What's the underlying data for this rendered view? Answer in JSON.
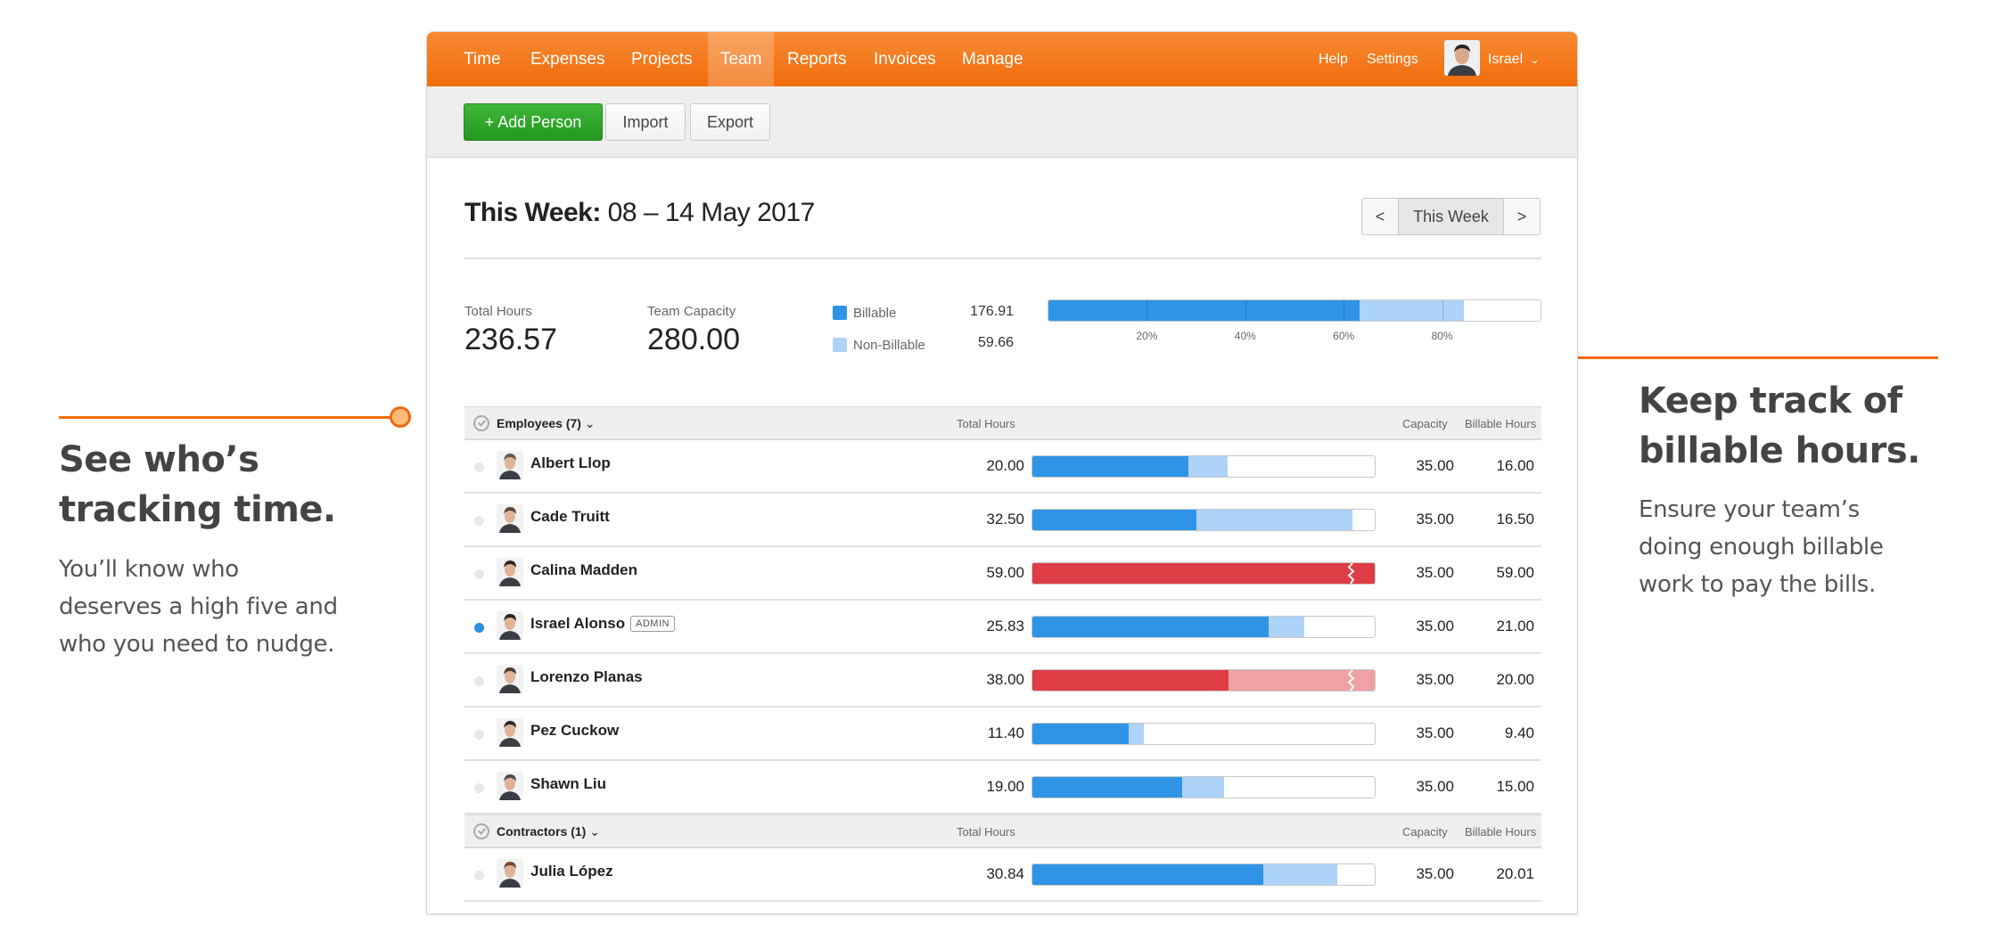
{
  "callouts": {
    "left": {
      "title_lines": [
        "See who’s",
        "tracking time."
      ],
      "body_lines": [
        "You’ll know who",
        "deserves a high five and",
        "who you need to nudge."
      ]
    },
    "right": {
      "title_lines": [
        "Keep track of",
        "billable hours."
      ],
      "body_lines": [
        "Ensure your team’s",
        "doing enough billable",
        "work to pay the bills."
      ]
    },
    "accent_color": "#f06a0c"
  },
  "nav": {
    "items": [
      {
        "label": "Time",
        "active": false
      },
      {
        "label": "Expenses",
        "active": false
      },
      {
        "label": "Projects",
        "active": false
      },
      {
        "label": "Team",
        "active": true
      },
      {
        "label": "Reports",
        "active": false
      },
      {
        "label": "Invoices",
        "active": false
      },
      {
        "label": "Manage",
        "active": false
      }
    ],
    "help": "Help",
    "settings": "Settings",
    "user": "Israel",
    "user_menu_icon": "chevron-down-icon",
    "color": "#f36c0b"
  },
  "toolbar": {
    "add_person": "+ Add Person",
    "import": "Import",
    "export": "Export"
  },
  "page": {
    "title_bold": "This Week:",
    "title_range": "08 – 14 May 2017",
    "week_nav": {
      "prev": "<",
      "current": "This Week",
      "next": ">"
    }
  },
  "summary": {
    "total_hours_label": "Total Hours",
    "total_hours": "236.57",
    "capacity_label": "Team Capacity",
    "capacity": "280.00",
    "billable_label": "Billable",
    "billable": "176.91",
    "non_billable_label": "Non-Billable",
    "non_billable": "59.66",
    "bar": {
      "billable_fraction": 0.632,
      "non_billable_fraction": 0.213,
      "ticks": [
        "20%",
        "40%",
        "60%",
        "80%"
      ]
    },
    "colors": {
      "billable": "#2f94e6",
      "non_billable": "#aed3f8"
    }
  },
  "groups": [
    {
      "title": "Employees (7)",
      "columns": {
        "total": "Total Hours",
        "capacity": "Capacity",
        "billable": "Billable Hours"
      },
      "people": [
        {
          "name": "Albert Llop",
          "admin": false,
          "active": false,
          "total": "20.00",
          "capacity": "35.00",
          "billable": "16.00",
          "bill_frac": 0.457,
          "nonbill_frac": 0.114,
          "over": false
        },
        {
          "name": "Cade Truitt",
          "admin": false,
          "active": false,
          "total": "32.50",
          "capacity": "35.00",
          "billable": "16.50",
          "bill_frac": 0.48,
          "nonbill_frac": 0.455,
          "over": false
        },
        {
          "name": "Calina Madden",
          "admin": false,
          "active": false,
          "total": "59.00",
          "capacity": "35.00",
          "billable": "59.00",
          "bill_frac": 1.0,
          "nonbill_frac": 0.0,
          "over": true
        },
        {
          "name": "Israel Alonso",
          "admin": true,
          "active": true,
          "total": "25.83",
          "capacity": "35.00",
          "billable": "21.00",
          "bill_frac": 0.69,
          "nonbill_frac": 0.103,
          "over": false
        },
        {
          "name": "Lorenzo Planas",
          "admin": false,
          "active": false,
          "total": "38.00",
          "capacity": "35.00",
          "billable": "20.00",
          "bill_frac": 0.572,
          "nonbill_frac": 0.428,
          "over": true
        },
        {
          "name": "Pez Cuckow",
          "admin": false,
          "active": false,
          "total": "11.40",
          "capacity": "35.00",
          "billable": "9.40",
          "bill_frac": 0.28,
          "nonbill_frac": 0.046,
          "over": false
        },
        {
          "name": "Shawn Liu",
          "admin": false,
          "active": false,
          "total": "19.00",
          "capacity": "35.00",
          "billable": "15.00",
          "bill_frac": 0.437,
          "nonbill_frac": 0.122,
          "over": false
        }
      ]
    },
    {
      "title": "Contractors (1)",
      "columns": {
        "total": "Total Hours",
        "capacity": "Capacity",
        "billable": "Billable Hours"
      },
      "people": [
        {
          "name": "Julia López",
          "admin": false,
          "active": false,
          "total": "30.84",
          "capacity": "35.00",
          "billable": "20.01",
          "bill_frac": 0.675,
          "nonbill_frac": 0.216,
          "over": false
        }
      ]
    }
  ],
  "admin_badge": "ADMIN",
  "bar_colors": {
    "billable": "#2f94e6",
    "non_billable": "#aed3f8",
    "over": "#de3d45",
    "over_light": "#f0a1a4"
  }
}
